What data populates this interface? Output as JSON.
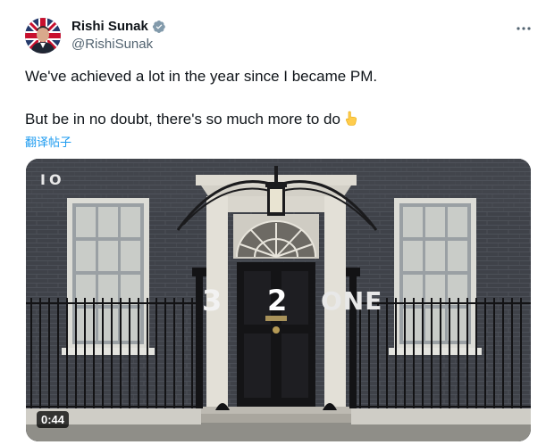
{
  "author": {
    "display_name": "Rishi Sunak",
    "handle": "@RishiSunak",
    "verified": true,
    "verified_color": "#829aab"
  },
  "tweet": {
    "line1": "We've achieved a lot in the year since I became PM.",
    "line2": "But be in no doubt, there's so much more to do",
    "emoji": "pointing-down-hand",
    "translate_label": "翻译帖子"
  },
  "media": {
    "overlay_top": "IO",
    "countdown": [
      "3",
      "2",
      "ONE"
    ],
    "duration": "0:44"
  },
  "icons": {
    "more": "more-horizontal-icon",
    "verified": "verified-badge-icon",
    "emoji": "pointing-down-emoji-icon"
  },
  "colors": {
    "text": "#0f1419",
    "secondary": "#536471",
    "link": "#1d9bf0"
  }
}
